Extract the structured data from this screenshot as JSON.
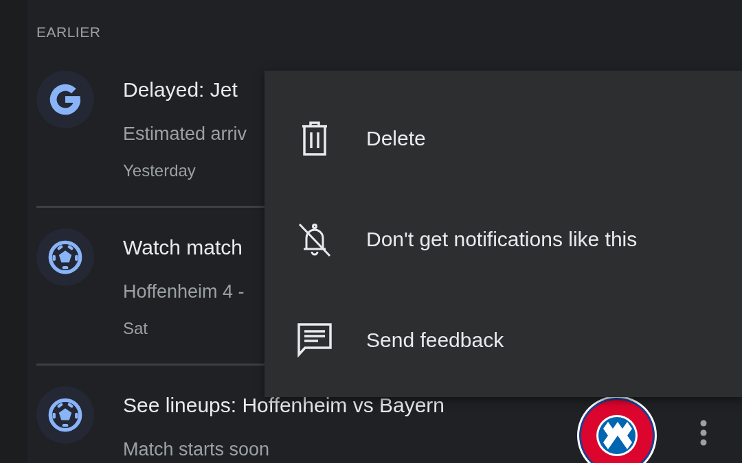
{
  "section": {
    "heading": "EARLIER"
  },
  "notifications": [
    {
      "kind": "g",
      "title": "Delayed: Jet",
      "body": "Estimated arriv",
      "time": "Yesterday"
    },
    {
      "kind": "ball",
      "title": "Watch match",
      "body": "Hoffenheim 4 -",
      "time": "Sat"
    },
    {
      "kind": "ball",
      "title": "See lineups: Hoffenheim vs Bayern",
      "body": "Match starts soon",
      "menu_button": true
    }
  ],
  "menu": {
    "items": [
      {
        "kind": "trash",
        "label": "Delete"
      },
      {
        "kind": "bell-off",
        "label": "Don't get notifications like this"
      },
      {
        "kind": "feedback",
        "label": "Send feedback"
      }
    ]
  }
}
